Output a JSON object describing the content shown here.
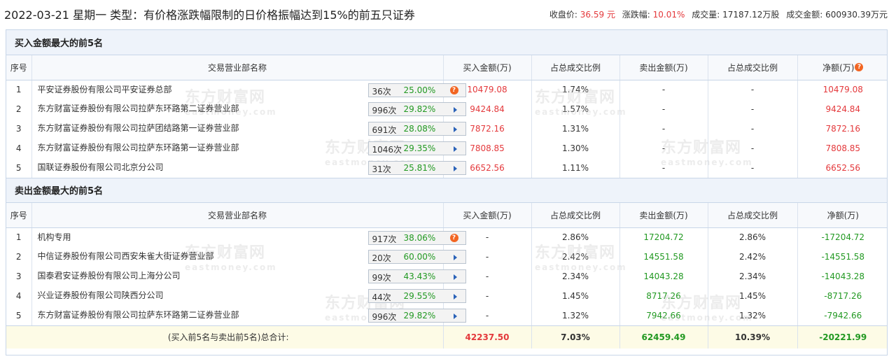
{
  "header": {
    "title": "2022-03-21 星期一 类型：有价格涨跌幅限制的日价格振幅达到15%的前五只证券",
    "close_label": "收盘价:",
    "close_value": "36.59 元",
    "change_label": "涨跌幅:",
    "change_value": "10.01%",
    "volume_label": "成交量:",
    "volume_value": "17187.12万股",
    "turnover_label": "成交金额:",
    "turnover_value": "600930.39万元"
  },
  "columns": {
    "seq": "序号",
    "name": "交易营业部名称",
    "buy_amount": "买入金额(万)",
    "buy_ratio": "占总成交比例",
    "sell_amount": "卖出金额(万)",
    "sell_ratio": "占总成交比例",
    "net": "净额(万)"
  },
  "buy_section": {
    "title": "买入金额最大的前5名",
    "rows": [
      {
        "seq": "1",
        "name": "平安证券股份有限公司平安证券总部",
        "times": "36次",
        "rate": "25.00%",
        "icon": "question-icon",
        "buy": "10479.08",
        "buy_ratio": "1.74%",
        "sell": "-",
        "sell_ratio": "-",
        "net": "10479.08"
      },
      {
        "seq": "2",
        "name": "东方财富证券股份有限公司拉萨东环路第二证券营业部",
        "times": "996次",
        "rate": "29.82%",
        "icon": "arrow-icon",
        "buy": "9424.84",
        "buy_ratio": "1.57%",
        "sell": "-",
        "sell_ratio": "-",
        "net": "9424.84"
      },
      {
        "seq": "3",
        "name": "东方财富证券股份有限公司拉萨团结路第一证券营业部",
        "times": "691次",
        "rate": "28.08%",
        "icon": "arrow-icon",
        "buy": "7872.16",
        "buy_ratio": "1.31%",
        "sell": "-",
        "sell_ratio": "-",
        "net": "7872.16"
      },
      {
        "seq": "4",
        "name": "东方财富证券股份有限公司拉萨东环路第一证券营业部",
        "times": "1046次",
        "rate": "29.35%",
        "icon": "arrow-icon",
        "buy": "7808.85",
        "buy_ratio": "1.30%",
        "sell": "-",
        "sell_ratio": "-",
        "net": "7808.85"
      },
      {
        "seq": "5",
        "name": "国联证券股份有限公司北京分公司",
        "times": "31次",
        "rate": "25.81%",
        "icon": "arrow-icon",
        "buy": "6652.56",
        "buy_ratio": "1.11%",
        "sell": "-",
        "sell_ratio": "-",
        "net": "6652.56"
      }
    ]
  },
  "sell_section": {
    "title": "卖出金额最大的前5名",
    "rows": [
      {
        "seq": "1",
        "name": "机构专用",
        "times": "917次",
        "rate": "38.06%",
        "icon": "question-icon",
        "buy": "-",
        "buy_ratio": "2.86%",
        "sell": "17204.72",
        "sell_ratio": "2.86%",
        "net": "-17204.72"
      },
      {
        "seq": "2",
        "name": "中信证券股份有限公司西安朱雀大街证券营业部",
        "times": "20次",
        "rate": "60.00%",
        "icon": "arrow-icon",
        "buy": "-",
        "buy_ratio": "2.42%",
        "sell": "14551.58",
        "sell_ratio": "2.42%",
        "net": "-14551.58"
      },
      {
        "seq": "3",
        "name": "国泰君安证券股份有限公司上海分公司",
        "times": "99次",
        "rate": "43.43%",
        "icon": "arrow-icon",
        "buy": "-",
        "buy_ratio": "2.34%",
        "sell": "14043.28",
        "sell_ratio": "2.34%",
        "net": "-14043.28"
      },
      {
        "seq": "4",
        "name": "兴业证券股份有限公司陕西分公司",
        "times": "44次",
        "rate": "29.55%",
        "icon": "arrow-icon",
        "buy": "-",
        "buy_ratio": "1.45%",
        "sell": "8717.26",
        "sell_ratio": "1.45%",
        "net": "-8717.26"
      },
      {
        "seq": "5",
        "name": "东方财富证券股份有限公司拉萨东环路第二证券营业部",
        "times": "996次",
        "rate": "29.82%",
        "icon": "arrow-icon",
        "buy": "-",
        "buy_ratio": "1.32%",
        "sell": "7942.66",
        "sell_ratio": "1.32%",
        "net": "-7942.66"
      }
    ]
  },
  "total": {
    "label": "(买入前5名与卖出前5名)总合计:",
    "buy": "42237.50",
    "buy_ratio": "7.03%",
    "sell": "62459.49",
    "sell_ratio": "10.39%",
    "net": "-20221.99"
  },
  "tip_glyph": "?",
  "watermark": {
    "cn": "东方财富网",
    "en": "eastmoney.com"
  },
  "colors": {
    "up": "#e4393c",
    "down": "#229922",
    "header_bg": "#eef3fa",
    "total_bg": "#fdfbe6"
  }
}
